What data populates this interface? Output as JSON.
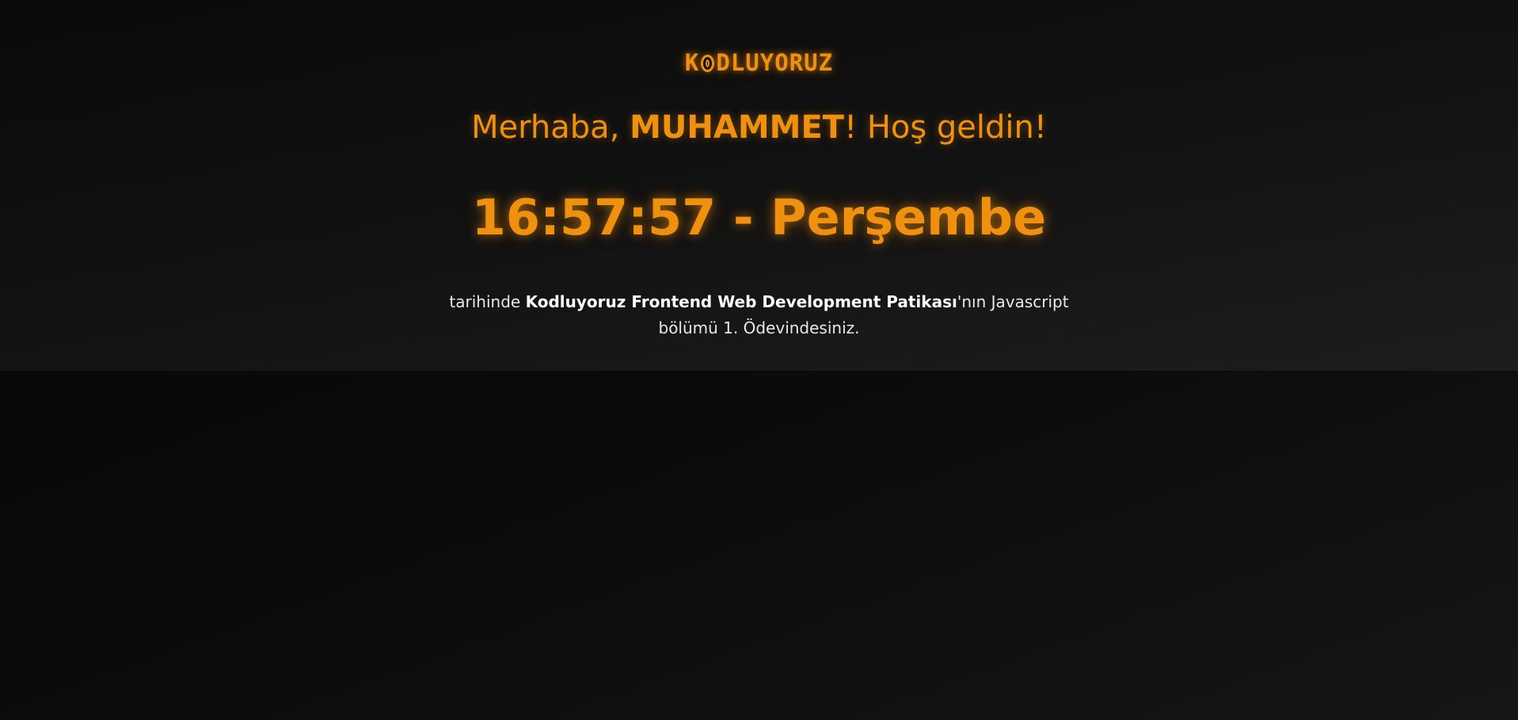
{
  "logo": {
    "text_start": "K",
    "text_end": "DLUYORUZ",
    "icon": "o-mark-icon",
    "color": "#f0900f"
  },
  "greeting": {
    "prefix": "Merhaba, ",
    "name": "MUHAMMET",
    "suffix": "! Hoş geldin!"
  },
  "clock": {
    "time": "16:57:57",
    "separator": " - ",
    "day": "Perşembe"
  },
  "info": {
    "prefix": "tarihinde ",
    "course": "Kodluyoruz Frontend Web Development Patikası",
    "line1_suffix": "'nın Javascript",
    "line2": "bölümü 1. Ödevindesiniz."
  },
  "colors": {
    "accent": "#f0900f",
    "background": "#0b0b0b",
    "text": "#e8e8e8"
  }
}
